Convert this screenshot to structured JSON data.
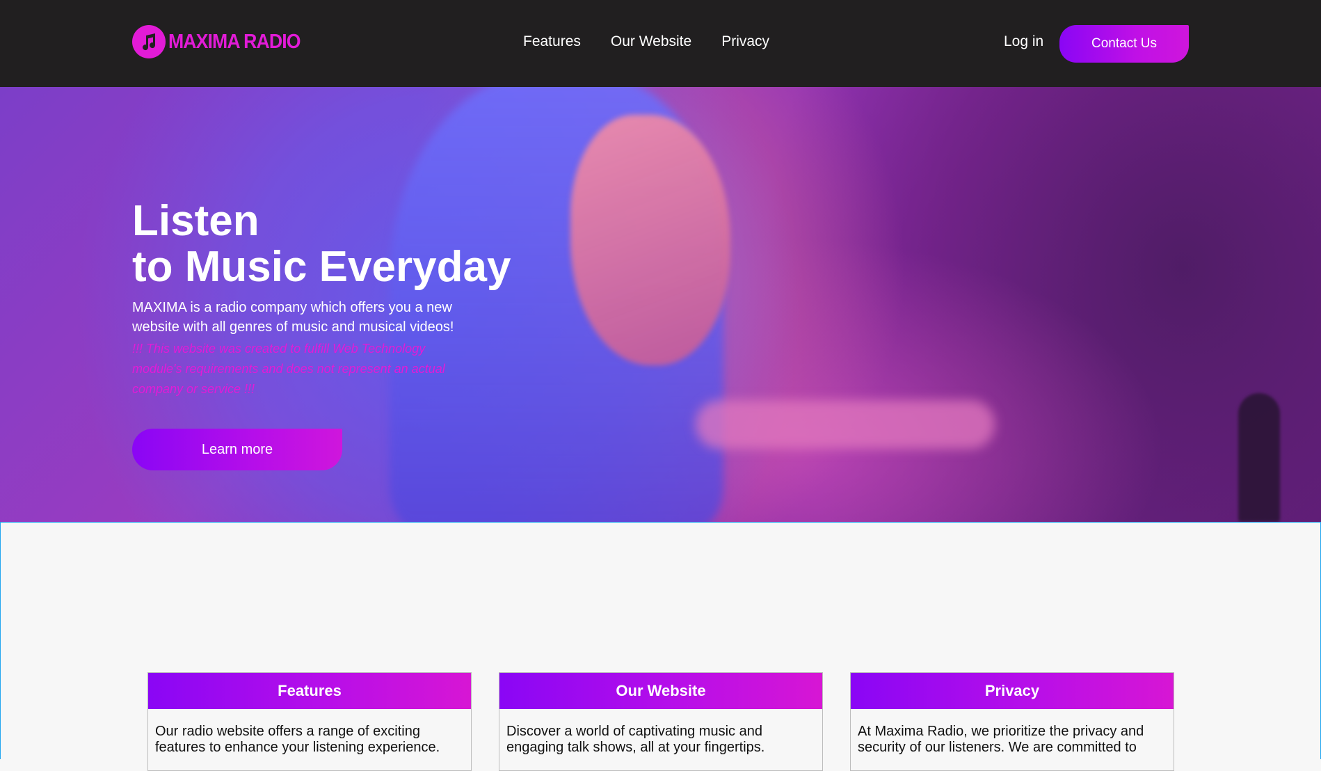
{
  "brand": {
    "logo_icon": "music-note-icon",
    "name": "MAXIMA RADIO",
    "color": "#e21bd7"
  },
  "nav": {
    "links": [
      "Features",
      "Our Website",
      "Privacy"
    ],
    "login": "Log in",
    "contact": "Contact Us"
  },
  "hero": {
    "title_line1": "Listen",
    "title_line2": "to Music Everyday",
    "description": "MAXIMA is a radio company which offers you a new website with all genres of music and musical videos!",
    "disclaimer": "!!! This website was created to fulfill Web Technology module's requirements and does not represent an actual company or service !!!",
    "button": "Learn more"
  },
  "cards": [
    {
      "title": "Features",
      "text": "Our radio website offers a range of exciting features to enhance your listening experience."
    },
    {
      "title": "Our Website",
      "text": "Discover a world of captivating music and engaging talk shows, all at your fingertips."
    },
    {
      "title": "Privacy",
      "text": "At Maxima Radio, we prioritize the privacy and security of our listeners. We are committed to"
    }
  ],
  "colors": {
    "accent_purple": "#8a06f5",
    "accent_magenta": "#cf16dc",
    "navbar_bg": "#211f20"
  }
}
